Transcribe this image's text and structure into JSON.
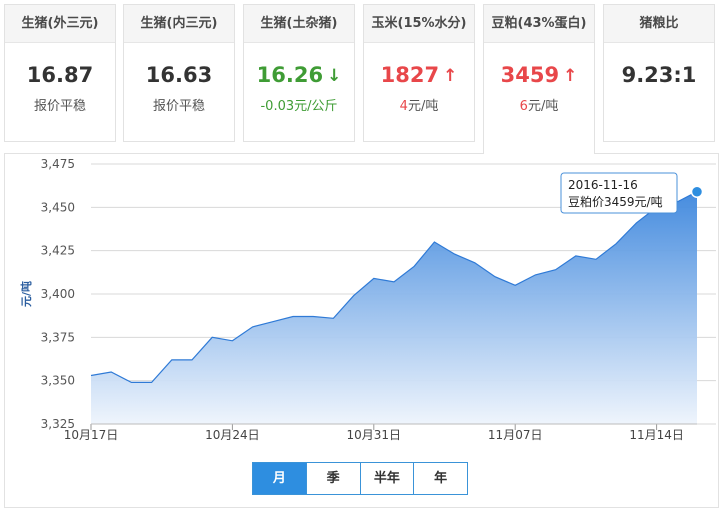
{
  "cards": [
    {
      "title": "生猪(外三元)",
      "price": "16.87",
      "arrow": "",
      "sub": "报价平稳",
      "color": ""
    },
    {
      "title": "生猪(内三元)",
      "price": "16.63",
      "arrow": "",
      "sub": "报价平稳",
      "color": ""
    },
    {
      "title": "生猪(土杂猪)",
      "price": "16.26",
      "arrow": "↓",
      "sub": "-0.03元/公斤",
      "color": "green"
    },
    {
      "title": "玉米(15%水分)",
      "price": "1827",
      "arrow": "↑",
      "sub_num": "4",
      "sub_unit": "元/吨",
      "color": "red"
    },
    {
      "title": "豆粕(43%蛋白)",
      "price": "3459",
      "arrow": "↑",
      "sub_num": "6",
      "sub_unit": "元/吨",
      "color": "red"
    },
    {
      "title": "猪粮比",
      "price": "9.23:1",
      "arrow": "",
      "sub": "",
      "color": ""
    }
  ],
  "tabs": [
    "月",
    "季",
    "半年",
    "年"
  ],
  "active_tab": 0,
  "colors": {
    "accent": "#2e8ee0",
    "up": "#e8474a",
    "down": "#3f9c35",
    "area_top": "#3c86dd",
    "area_bottom": "#eef4fc"
  },
  "tooltip": {
    "date": "2016-11-16",
    "label": "豆粕价3459元/吨"
  },
  "chart_data": {
    "type": "area",
    "ylabel": "元/吨",
    "ylim": [
      3325,
      3475
    ],
    "yticks": [
      3325,
      3350,
      3375,
      3400,
      3425,
      3450,
      3475
    ],
    "ytick_labels": [
      "3,325",
      "3,350",
      "3,375",
      "3,400",
      "3,425",
      "3,450",
      "3,475"
    ],
    "xticks": [
      {
        "date": "2016-10-17",
        "label": "10月17日"
      },
      {
        "date": "2016-10-24",
        "label": "10月24日"
      },
      {
        "date": "2016-10-31",
        "label": "10月31日"
      },
      {
        "date": "2016-11-07",
        "label": "11月07日"
      },
      {
        "date": "2016-11-14",
        "label": "11月14日"
      }
    ],
    "x": [
      "2016-10-17",
      "2016-10-18",
      "2016-10-19",
      "2016-10-20",
      "2016-10-21",
      "2016-10-22",
      "2016-10-23",
      "2016-10-24",
      "2016-10-25",
      "2016-10-26",
      "2016-10-27",
      "2016-10-28",
      "2016-10-29",
      "2016-10-30",
      "2016-10-31",
      "2016-11-01",
      "2016-11-02",
      "2016-11-03",
      "2016-11-04",
      "2016-11-05",
      "2016-11-06",
      "2016-11-07",
      "2016-11-08",
      "2016-11-09",
      "2016-11-10",
      "2016-11-11",
      "2016-11-12",
      "2016-11-13",
      "2016-11-14",
      "2016-11-15",
      "2016-11-16"
    ],
    "series": [
      {
        "values": [
          3353,
          3355,
          3349,
          3349,
          3362,
          3362,
          3375,
          3373,
          3381,
          3384,
          3387,
          3387,
          3386,
          3399,
          3409,
          3407,
          3416,
          3430,
          3423,
          3418,
          3410,
          3405,
          3411,
          3414,
          3422,
          3420,
          3429,
          3441,
          3450,
          3453,
          3459
        ]
      }
    ],
    "highlight_index": 30
  }
}
